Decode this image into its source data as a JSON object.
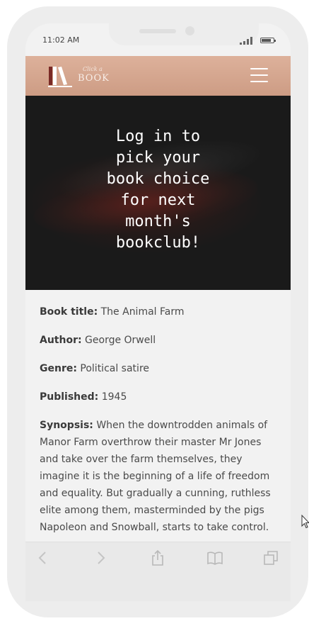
{
  "status_bar": {
    "time": "11:02 AM",
    "signal_bars": 4,
    "battery_level": 0.85
  },
  "header": {
    "logo_small": "Click a",
    "logo_big": "BOOK",
    "menu_icon": "hamburger-menu-icon",
    "background_colors": [
      "#ddb19b",
      "#cd9c84"
    ]
  },
  "hero": {
    "text": "Log in to\npick your\nbook choice\nfor next\nmonth's\nbookclub!"
  },
  "details": {
    "title_label": "Book title:",
    "title_value": " The Animal Farm",
    "author_label": "Author:",
    "author_value": " George Orwell",
    "genre_label": "Genre:",
    "genre_value": " Political satire",
    "published_label": "Published:",
    "published_value": " 1945",
    "synopsis_label": "Synopsis:",
    "synopsis_value": " When the downtrodden animals of Manor Farm overthrow their master Mr Jones and take over the farm themselves, they imagine it is the beginning of a life of freedom and equality. But gradually a cunning, ruthless elite among them, masterminded by the pigs Napoleon and Snowball, starts to take control."
  },
  "browser_toolbar": {
    "icons": [
      "back-icon",
      "forward-icon",
      "share-icon",
      "bookmarks-icon",
      "tabs-icon"
    ]
  }
}
